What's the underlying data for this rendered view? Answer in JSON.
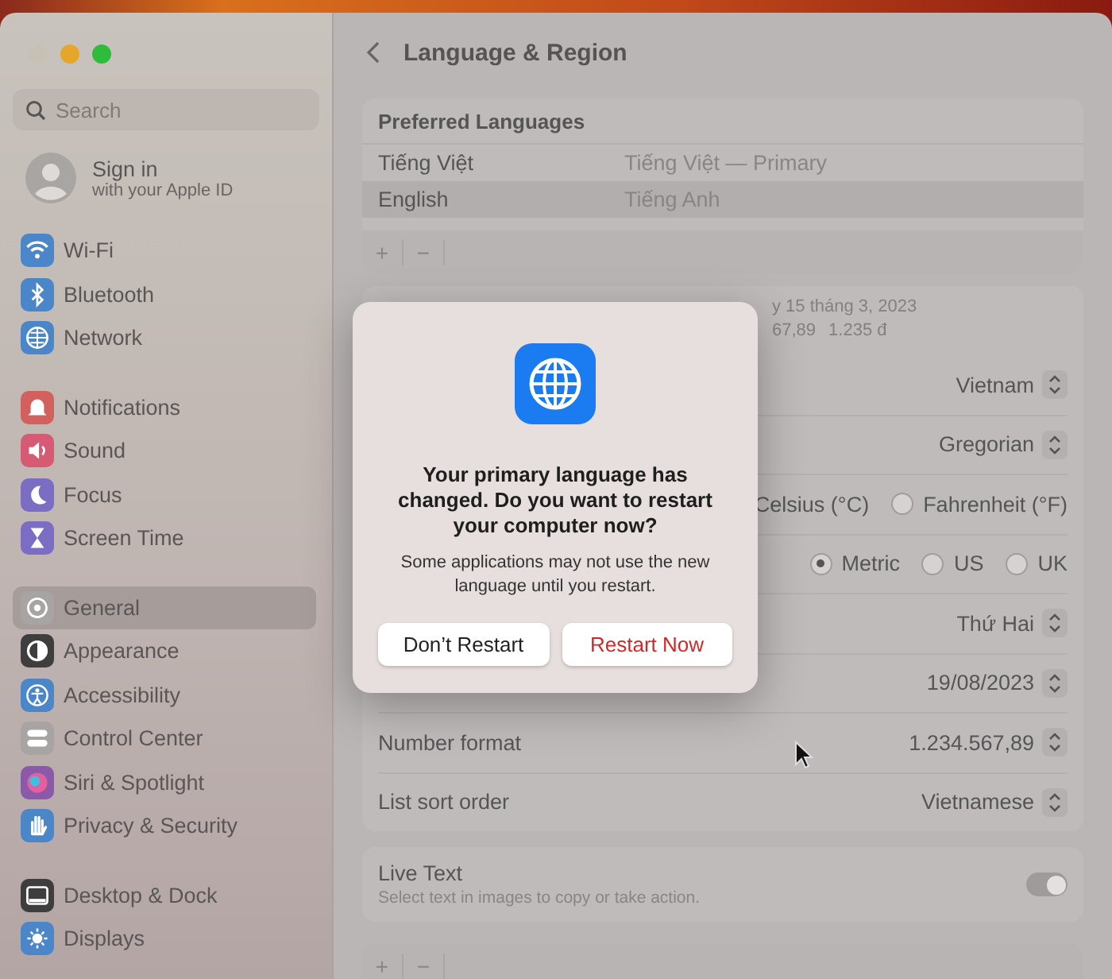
{
  "sidebar": {
    "search": {
      "placeholder": "Search"
    },
    "account": {
      "title": "Sign in",
      "subtitle": "with your Apple ID"
    },
    "groups": [
      [
        {
          "label": "Wi-Fi",
          "kind": "wifi",
          "color": "#4a86c8",
          "selected": false
        },
        {
          "label": "Bluetooth",
          "kind": "bluetooth",
          "color": "#4a86c8",
          "selected": false
        },
        {
          "label": "Network",
          "kind": "globe",
          "color": "#4a86c8",
          "selected": false
        }
      ],
      [
        {
          "label": "Notifications",
          "kind": "bell",
          "color": "#d2615e",
          "selected": false
        },
        {
          "label": "Sound",
          "kind": "speaker",
          "color": "#d65a74",
          "selected": false
        },
        {
          "label": "Focus",
          "kind": "moon",
          "color": "#7b6cc4",
          "selected": false
        },
        {
          "label": "Screen Time",
          "kind": "hourglass",
          "color": "#7b6cc4",
          "selected": false
        }
      ],
      [
        {
          "label": "General",
          "kind": "gear",
          "color": "#a8a4a4",
          "selected": true
        },
        {
          "label": "Appearance",
          "kind": "appearance",
          "color": "#3e3e3e",
          "selected": false
        },
        {
          "label": "Accessibility",
          "kind": "person",
          "color": "#4a86c8",
          "selected": false
        },
        {
          "label": "Control Center",
          "kind": "toggles",
          "color": "#a8a4a4",
          "selected": false
        },
        {
          "label": "Siri & Spotlight",
          "kind": "orb",
          "color": "#8a5aa8",
          "selected": false
        },
        {
          "label": "Privacy & Security",
          "kind": "hand",
          "color": "#4a86c8",
          "selected": false
        }
      ],
      [
        {
          "label": "Desktop & Dock",
          "kind": "dock",
          "color": "#3e3e3e",
          "selected": false
        },
        {
          "label": "Displays",
          "kind": "sun",
          "color": "#4a86c8",
          "selected": false
        }
      ]
    ]
  },
  "header": {
    "title": "Language & Region"
  },
  "preferred_languages": {
    "title": "Preferred Languages",
    "rows": [
      {
        "language": "Tiếng Việt",
        "native": "Tiếng Việt — Primary",
        "selected": false
      },
      {
        "language": "English",
        "native": "Tiếng Anh",
        "selected": true
      }
    ],
    "buttons": [
      "+",
      "−"
    ]
  },
  "settings": [
    {
      "kind": "preview",
      "lines": [
        "y 15 tháng 3, 2023",
        [
          "67,89",
          "1.235 đ"
        ]
      ]
    },
    {
      "kind": "popup",
      "value": "Vietnam"
    },
    {
      "kind": "popup",
      "value": "Gregorian"
    },
    {
      "kind": "radio",
      "options": [
        {
          "label": "Celsius (°C)"
        },
        {
          "label": "Fahrenheit (°F)",
          "selected": false
        }
      ]
    },
    {
      "kind": "radio",
      "options": [
        {
          "label": "Metric",
          "selected": true
        },
        {
          "label": "US",
          "selected": false
        },
        {
          "label": "UK",
          "selected": false
        }
      ]
    },
    {
      "kind": "popup",
      "value": "Thứ Hai"
    },
    {
      "kind": "popup",
      "value": "19/08/2023"
    },
    {
      "kind": "popup",
      "label": "Number format",
      "value": "1.234.567,89"
    },
    {
      "kind": "popup",
      "label": "List sort order",
      "value": "Vietnamese"
    }
  ],
  "live_text": {
    "title": "Live Text",
    "subtitle": "Select text in images to copy or take action.",
    "on": true
  },
  "bottom_buttons": [
    "+",
    "−"
  ],
  "dialog": {
    "title": "Your primary language has changed. Do you want to restart your computer now?",
    "message": "Some applications may not use the new language until you restart.",
    "buttons": [
      {
        "label": "Don’t Restart",
        "kind": "cancel"
      },
      {
        "label": "Restart Now",
        "kind": "destructive"
      }
    ]
  }
}
